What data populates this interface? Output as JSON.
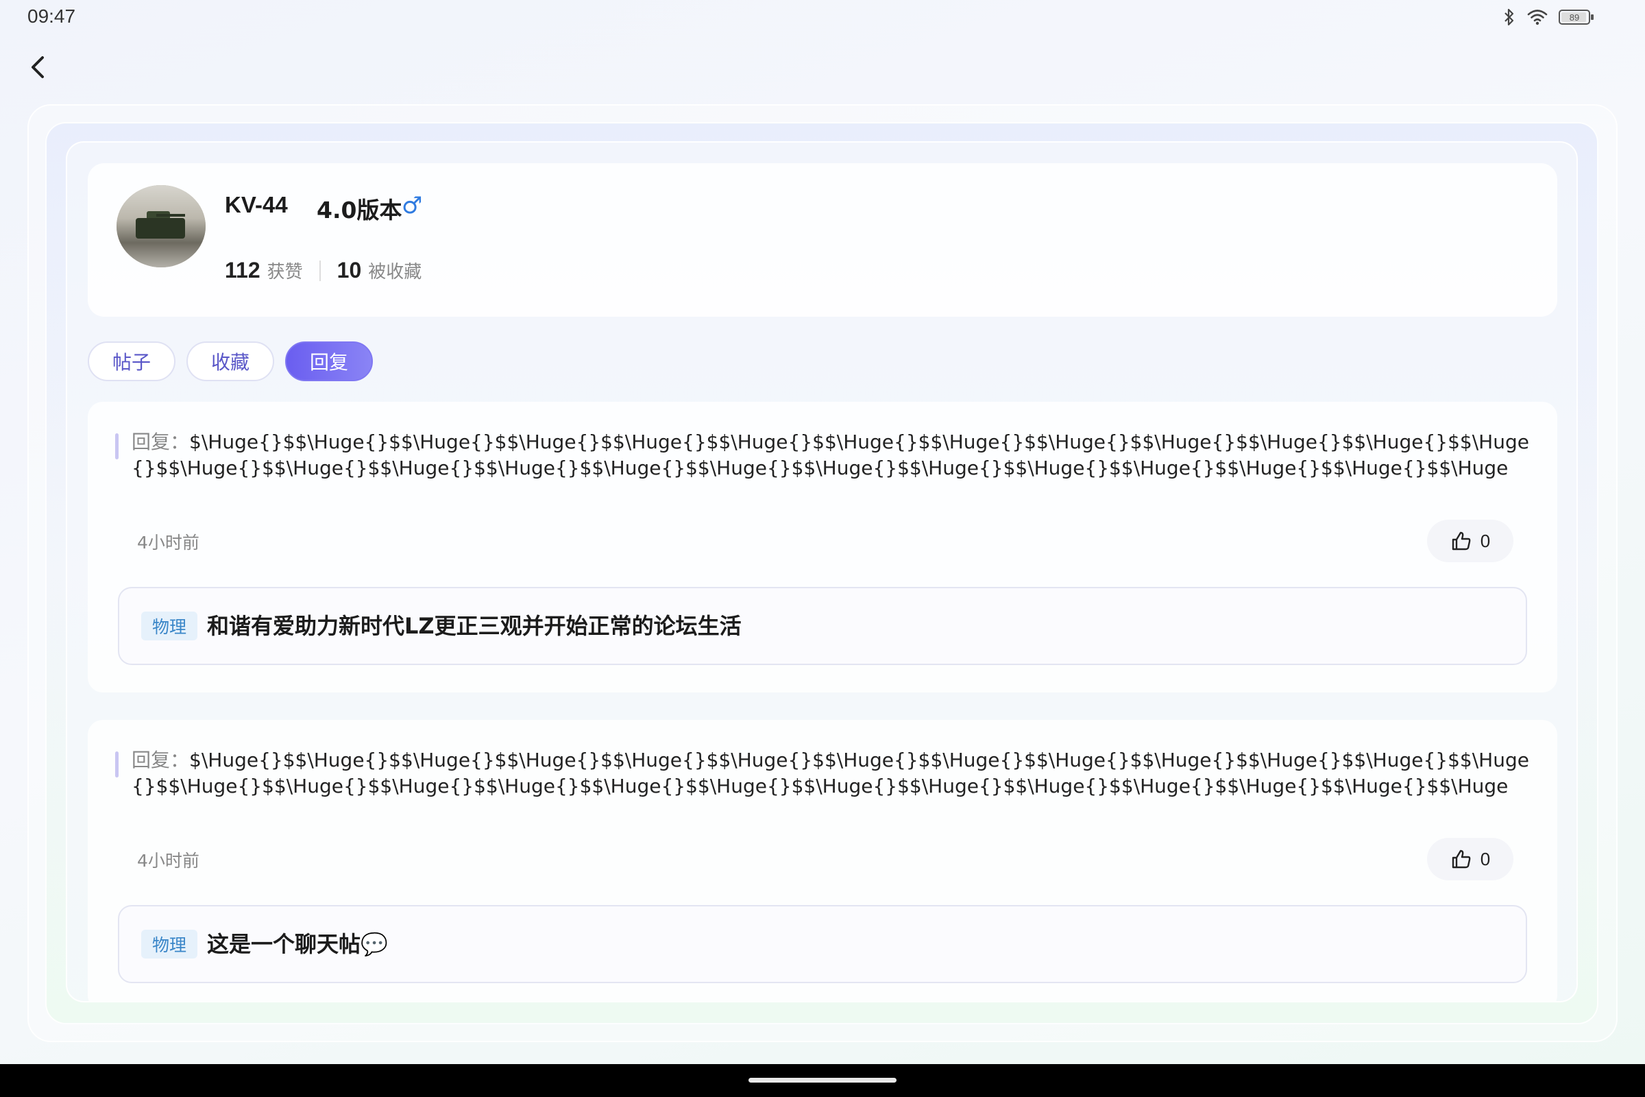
{
  "status_bar": {
    "time": "09:47",
    "battery": "89",
    "icons": [
      "bluetooth-icon",
      "wifi-icon",
      "battery-icon"
    ]
  },
  "back_icon": "chevron-left-icon",
  "profile": {
    "username": "KV-44",
    "level": "4.0版本",
    "gender_symbol": "♂",
    "likes_count": "112",
    "likes_label": "获赞",
    "favorited_count": "10",
    "favorited_label": "被收藏"
  },
  "tabs": [
    {
      "label": "帖子",
      "active": false
    },
    {
      "label": "收藏",
      "active": false
    },
    {
      "label": "回复",
      "active": true
    }
  ],
  "replies": [
    {
      "prefix": "回复：",
      "text": "$\\Huge{}$$\\Huge{}$$\\Huge{}$$\\Huge{}$$\\Huge{}$$\\Huge{}$$\\Huge{}$$\\Huge{}$$\\Huge{}$$\\Huge{}$$\\Huge{}$$\\Huge{}$$\\Huge{}$$\\Huge{}$$\\Huge{}$$\\Huge{}$$\\Huge{}$$\\Huge{}$$\\Huge{}$$\\Huge{}$$\\Huge{}$$\\Huge{}$$\\Huge{}$$\\Huge{}$$\\Huge{}$$\\Huge{}$$\\Huge{}$$\\Huge{}$$\\Huge{}$$\\Huge{...",
      "time": "4小时前",
      "likes": "0",
      "post_tag": "物理",
      "post_title": "和谐有爱助力新时代LZ更正三观并开始正常的论坛生活"
    },
    {
      "prefix": "回复：",
      "text": "$\\Huge{}$$\\Huge{}$$\\Huge{}$$\\Huge{}$$\\Huge{}$$\\Huge{}$$\\Huge{}$$\\Huge{}$$\\Huge{}$$\\Huge{}$$\\Huge{}$$\\Huge{}$$\\Huge{}$$\\Huge{}$$\\Huge{}$$\\Huge{}$$\\Huge{}$$\\Huge{}$$\\Huge{}$$\\Huge{}$$\\Huge{}$$\\Huge{}$$\\Huge{}$$\\Huge{}$$\\Huge{}$$\\Huge{}$$\\Huge{}$$\\Huge{}$$\\Huge{}$$\\Huge{...",
      "time": "4小时前",
      "likes": "0",
      "post_tag": "物理",
      "post_title": "这是一个聊天帖💬"
    }
  ]
}
